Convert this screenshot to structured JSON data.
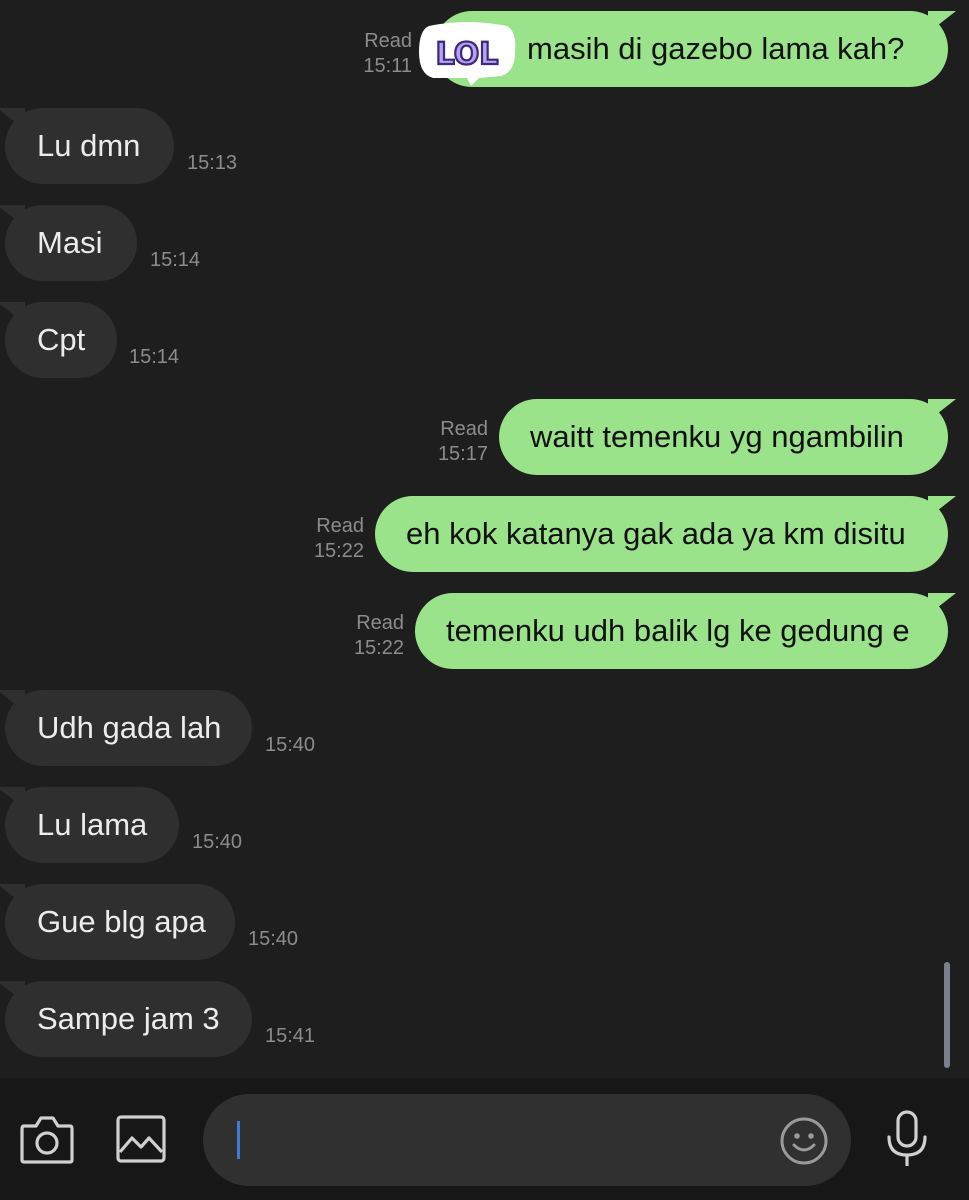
{
  "messages": [
    {
      "text": "masih di gazebo lama kah?",
      "read": "Read",
      "time": "15:11",
      "sticker": "LOL"
    },
    {
      "text": "Lu dmn",
      "time": "15:13"
    },
    {
      "text": "Masi",
      "time": "15:14"
    },
    {
      "text": "Cpt",
      "time": "15:14"
    },
    {
      "text": "waitt temenku yg ngambilin",
      "read": "Read",
      "time": "15:17"
    },
    {
      "text": "eh kok katanya gak ada ya km disitu",
      "read": "Read",
      "time": "15:22"
    },
    {
      "text": "temenku udh balik lg ke gedung e",
      "read": "Read",
      "time": "15:22"
    },
    {
      "text": "Udh gada lah",
      "time": "15:40"
    },
    {
      "text": "Lu lama",
      "time": "15:40"
    },
    {
      "text": "Gue blg apa",
      "time": "15:40"
    },
    {
      "text": "Sampe jam 3",
      "time": "15:41"
    }
  ],
  "input": {
    "value": ""
  },
  "icons": {
    "camera": "camera-icon",
    "gallery": "image-icon",
    "emoji": "emoji-icon",
    "mic": "microphone-icon"
  },
  "colors": {
    "background": "#1e1e1e",
    "outgoing_bubble": "#9ae38a",
    "incoming_bubble": "#2f2f2f",
    "bottom_bar": "#171717",
    "caret": "#3f7ad9"
  }
}
